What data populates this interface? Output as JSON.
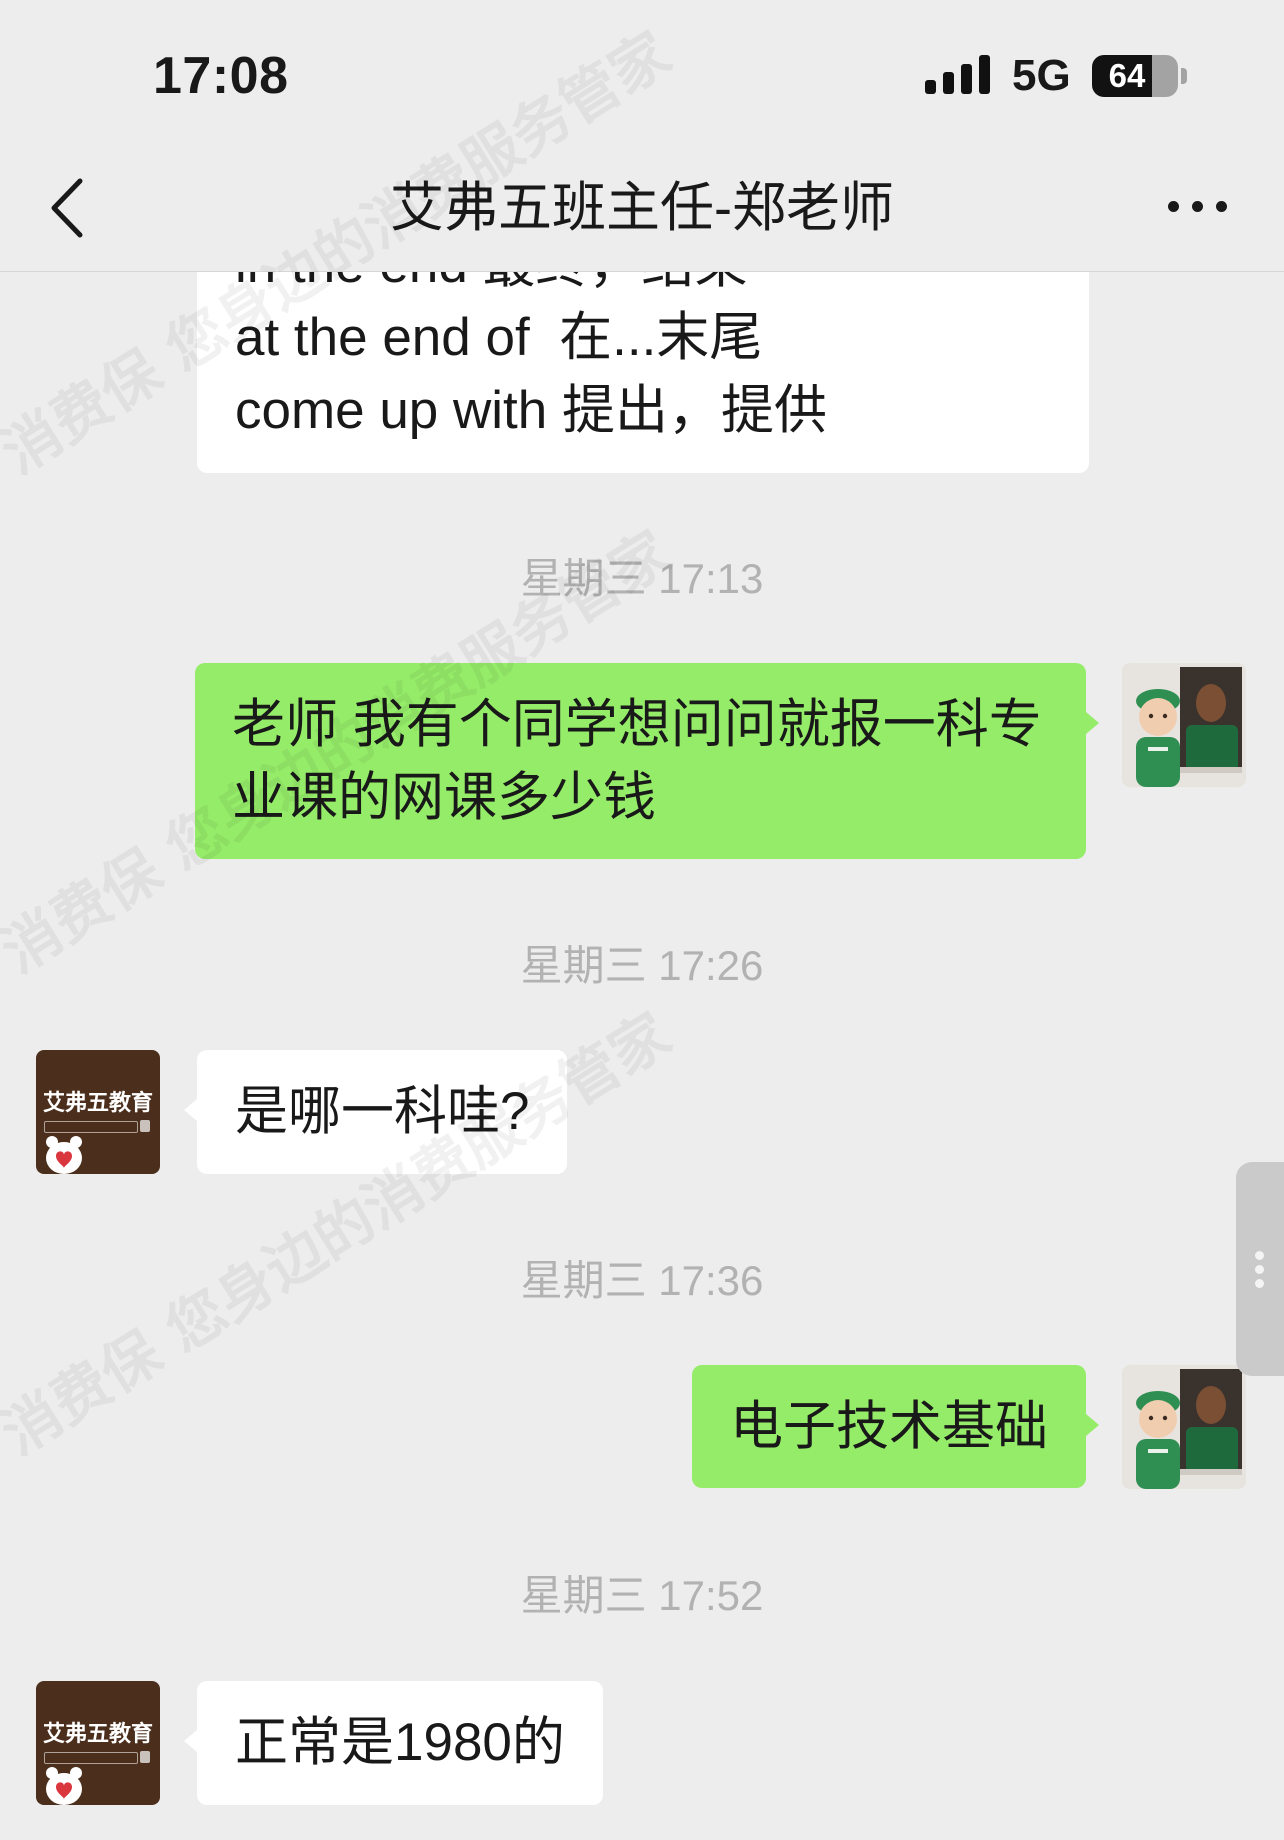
{
  "status_bar": {
    "time": "17:08",
    "network": "5G",
    "battery_level": "64",
    "signal_icon": "signal-strength-icon",
    "battery_icon": "battery-icon"
  },
  "header": {
    "title": "艾弗五班主任-郑老师",
    "back_icon": "chevron-left-icon",
    "more_icon": "more-dots-icon"
  },
  "watermark": {
    "text": "消费保 您身边的消费服务管家"
  },
  "chat": {
    "earlier_message": {
      "lines": [
        "in the end 最终，结果",
        "at the end of  在...末尾",
        "come up with 提出，提供"
      ]
    },
    "timestamps": [
      "星期三 17:13",
      "星期三 17:26",
      "星期三 17:36",
      "星期三 17:52"
    ],
    "messages": [
      {
        "outgoing": true,
        "text": "老师 我有个同学想问问就报一科专业课的网课多少钱"
      },
      {
        "outgoing": false,
        "text": "是哪一科哇?"
      },
      {
        "outgoing": true,
        "text": "电子技术基础"
      },
      {
        "outgoing": false,
        "text": "正常是1980的"
      }
    ]
  },
  "contact_avatar": {
    "logo_text": "艾弗五教育"
  },
  "colors": {
    "background": "#ededed",
    "sent_bubble": "#95ec69",
    "received_bubble": "#ffffff",
    "timestamp": "#b2b2b2",
    "avatar_brown": "#4b2f1c"
  }
}
